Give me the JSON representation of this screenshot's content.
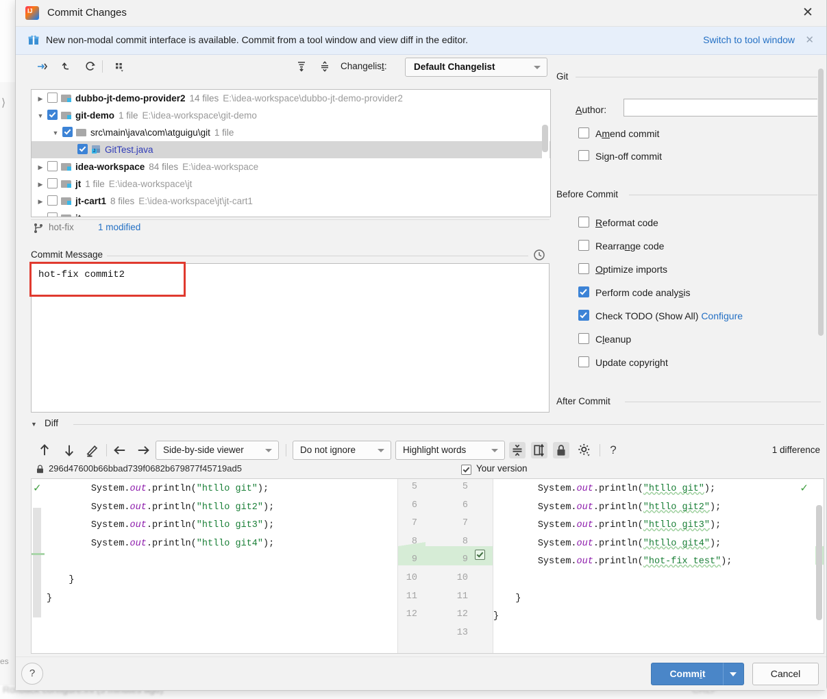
{
  "window": {
    "title": "Commit Changes",
    "close_label": "✕",
    "logo_name": "intellij-idea-logo"
  },
  "banner": {
    "text": "New non-modal commit interface is available. Commit from a tool window and view diff in the editor.",
    "link": "Switch to tool window",
    "close": "✕"
  },
  "toolbar": {
    "icons": [
      {
        "name": "show-diff-icon",
        "glyph": "→"
      },
      {
        "name": "rollback-icon",
        "glyph": "↺"
      },
      {
        "name": "refresh-icon",
        "glyph": "⟳"
      },
      {
        "name": "group-by-icon",
        "glyph": "∷"
      },
      {
        "name": "expand-all-icon",
        "glyph": "⩝"
      },
      {
        "name": "collapse-all-icon",
        "glyph": "⩞"
      }
    ],
    "changelist_label": "Changelis",
    "changelist_mnemonic": "t",
    "changelist_label_suffix": ":",
    "changelist_value": "Default Changelist"
  },
  "tree": {
    "rows": [
      {
        "name": "dubbo-jt-demo-provider2",
        "count": "14 files",
        "path": "E:\\idea-workspace\\dubbo-jt-demo-provider2",
        "checked": false,
        "expanded": false,
        "indent": 0,
        "icon": "module",
        "selected": false,
        "twisty": "▶"
      },
      {
        "name": "git-demo",
        "count": "1 file",
        "path": "E:\\idea-workspace\\git-demo",
        "checked": true,
        "expanded": true,
        "indent": 0,
        "icon": "module",
        "selected": false,
        "twisty": "▼"
      },
      {
        "name": "src\\main\\java\\com\\atguigu\\git",
        "count": "1 file",
        "path": "",
        "checked": true,
        "expanded": true,
        "indent": 1,
        "icon": "folder",
        "selected": false,
        "twisty": "▼"
      },
      {
        "name": "GitTest.java",
        "count": "",
        "path": "",
        "checked": true,
        "expanded": null,
        "indent": 2,
        "icon": "java",
        "selected": true,
        "twisty": ""
      },
      {
        "name": "idea-workspace",
        "count": "84 files",
        "path": "E:\\idea-workspace",
        "checked": false,
        "expanded": false,
        "indent": 0,
        "icon": "module",
        "selected": false,
        "twisty": "▶"
      },
      {
        "name": "jt",
        "count": "1 file",
        "path": "E:\\idea-workspace\\jt",
        "checked": false,
        "expanded": false,
        "indent": 0,
        "icon": "module",
        "selected": false,
        "twisty": "▶"
      },
      {
        "name": "jt-cart1",
        "count": "8 files",
        "path": "E:\\idea-workspace\\jt\\jt-cart1",
        "checked": false,
        "expanded": false,
        "indent": 0,
        "icon": "module",
        "selected": false,
        "twisty": "▶"
      }
    ]
  },
  "branch": {
    "name": "hot-fix",
    "modified": "1 modified",
    "icon": "branch-icon"
  },
  "commit_message": {
    "legend": "Commit Message",
    "value": "hot-fix commit2",
    "history_icon": "clock-history-icon"
  },
  "git_section": {
    "title": "Git",
    "author_label_prefix": "A",
    "author_label_rest": "uthor:",
    "author_value": "",
    "options": [
      {
        "name": "amend-commit",
        "pre": "A",
        "mnemonic": "m",
        "post": "end commit",
        "checked": false
      },
      {
        "name": "sign-off-commit",
        "pre": "Si",
        "mnemonic": "g",
        "post": "n-off commit",
        "checked": false
      }
    ]
  },
  "before_commit": {
    "title": "Before Commit",
    "options": [
      {
        "name": "reformat-code",
        "pre": "",
        "mnemonic": "R",
        "post": "eformat code",
        "checked": false
      },
      {
        "name": "rearrange-code",
        "pre": "Rearra",
        "mnemonic": "n",
        "post": "ge code",
        "checked": false
      },
      {
        "name": "optimize-imports",
        "pre": "",
        "mnemonic": "O",
        "post": "ptimize imports",
        "checked": false
      },
      {
        "name": "perform-code-analysis",
        "pre": "Perform code analy",
        "mnemonic": "s",
        "post": "is",
        "checked": true
      },
      {
        "name": "check-todo",
        "pre": "Check TODO (Show All)",
        "mnemonic": "",
        "post": "",
        "checked": true,
        "link": "Configure"
      },
      {
        "name": "cleanup",
        "pre": "C",
        "mnemonic": "l",
        "post": "eanup",
        "checked": false
      },
      {
        "name": "update-copyright",
        "pre": "Update copyright",
        "mnemonic": "",
        "post": "",
        "checked": false
      }
    ]
  },
  "after_commit": {
    "title": "After Commit"
  },
  "diff": {
    "legend": "Diff",
    "twisty": "▼",
    "nav_icons": [
      {
        "name": "previous-difference-icon",
        "glyph": "↑"
      },
      {
        "name": "next-difference-icon",
        "glyph": "↓"
      },
      {
        "name": "edit-source-icon",
        "glyph": "✎"
      },
      {
        "name": "apply-left-icon",
        "glyph": "←"
      },
      {
        "name": "apply-right-icon",
        "glyph": "→"
      }
    ],
    "viewer_mode": "Side-by-side viewer",
    "whitespace_mode": "Do not ignore",
    "highlight_mode": "Highlight words",
    "toggle_icons": [
      {
        "name": "collapse-unchanged-icon",
        "glyph": "⩞"
      },
      {
        "name": "highlight-split-icon",
        "glyph": "◫"
      },
      {
        "name": "read-only-lock-icon",
        "glyph": "🔒"
      },
      {
        "name": "settings-gear-icon",
        "glyph": "⚙"
      },
      {
        "name": "help-question-icon",
        "glyph": "?"
      }
    ],
    "difference_count": "1 difference",
    "revision_hash": "296d47600b66bbad739f0682b679877f45719ad5",
    "revision_lock_icon": "lock-icon",
    "your_version_label": "Your version",
    "your_version_checked": true,
    "left_lines": [
      {
        "indent": 8,
        "prefix": "System.",
        "field": "out",
        "mid": ".println(",
        "str": "\"htllo git\"",
        "suffix": ");"
      },
      {
        "indent": 8,
        "prefix": "System.",
        "field": "out",
        "mid": ".println(",
        "str": "\"htllo git2\"",
        "suffix": ");"
      },
      {
        "indent": 8,
        "prefix": "System.",
        "field": "out",
        "mid": ".println(",
        "str": "\"htllo git3\"",
        "suffix": ");"
      },
      {
        "indent": 8,
        "prefix": "System.",
        "field": "out",
        "mid": ".println(",
        "str": "\"htllo git4\"",
        "suffix": ");"
      },
      {
        "indent": 0,
        "prefix": "",
        "field": "",
        "mid": "",
        "str": "",
        "suffix": ""
      },
      {
        "indent": 4,
        "prefix": "}",
        "field": "",
        "mid": "",
        "str": "",
        "suffix": ""
      },
      {
        "indent": 0,
        "prefix": "}",
        "field": "",
        "mid": "",
        "str": "",
        "suffix": ""
      }
    ],
    "right_lines": [
      {
        "indent": 8,
        "prefix": "System.",
        "field": "out",
        "mid": ".println(",
        "str": "\"htllo git\"",
        "suffix": ");",
        "added": false
      },
      {
        "indent": 8,
        "prefix": "System.",
        "field": "out",
        "mid": ".println(",
        "str": "\"htllo git2\"",
        "suffix": ");",
        "added": false
      },
      {
        "indent": 8,
        "prefix": "System.",
        "field": "out",
        "mid": ".println(",
        "str": "\"htllo git3\"",
        "suffix": ");",
        "added": false
      },
      {
        "indent": 8,
        "prefix": "System.",
        "field": "out",
        "mid": ".println(",
        "str": "\"htllo git4\"",
        "suffix": ");",
        "added": false
      },
      {
        "indent": 8,
        "prefix": "System.",
        "field": "out",
        "mid": ".println(",
        "str": "\"hot-fix test\"",
        "suffix": ");",
        "added": true
      },
      {
        "indent": 0,
        "prefix": "",
        "field": "",
        "mid": "",
        "str": "",
        "suffix": "",
        "added": false
      },
      {
        "indent": 4,
        "prefix": "}",
        "field": "",
        "mid": "",
        "str": "",
        "suffix": "",
        "added": false
      },
      {
        "indent": 0,
        "prefix": "}",
        "field": "",
        "mid": "",
        "str": "",
        "suffix": "",
        "added": false
      }
    ],
    "left_line_numbers": [
      "5",
      "6",
      "7",
      "8",
      "9",
      "10",
      "11",
      "12"
    ],
    "right_line_numbers": [
      "5",
      "6",
      "7",
      "8",
      "9",
      "10",
      "11",
      "12",
      "13"
    ]
  },
  "bottom": {
    "help": "?",
    "commit_pre": "Comm",
    "commit_mnemonic": "i",
    "commit_post": "t",
    "cancel": "Cancel"
  },
  "background": {
    "status_text": "Rollback   configure.ini (5 minutes ago)",
    "status_right": "CRLF",
    "sidebar_label": "es"
  }
}
